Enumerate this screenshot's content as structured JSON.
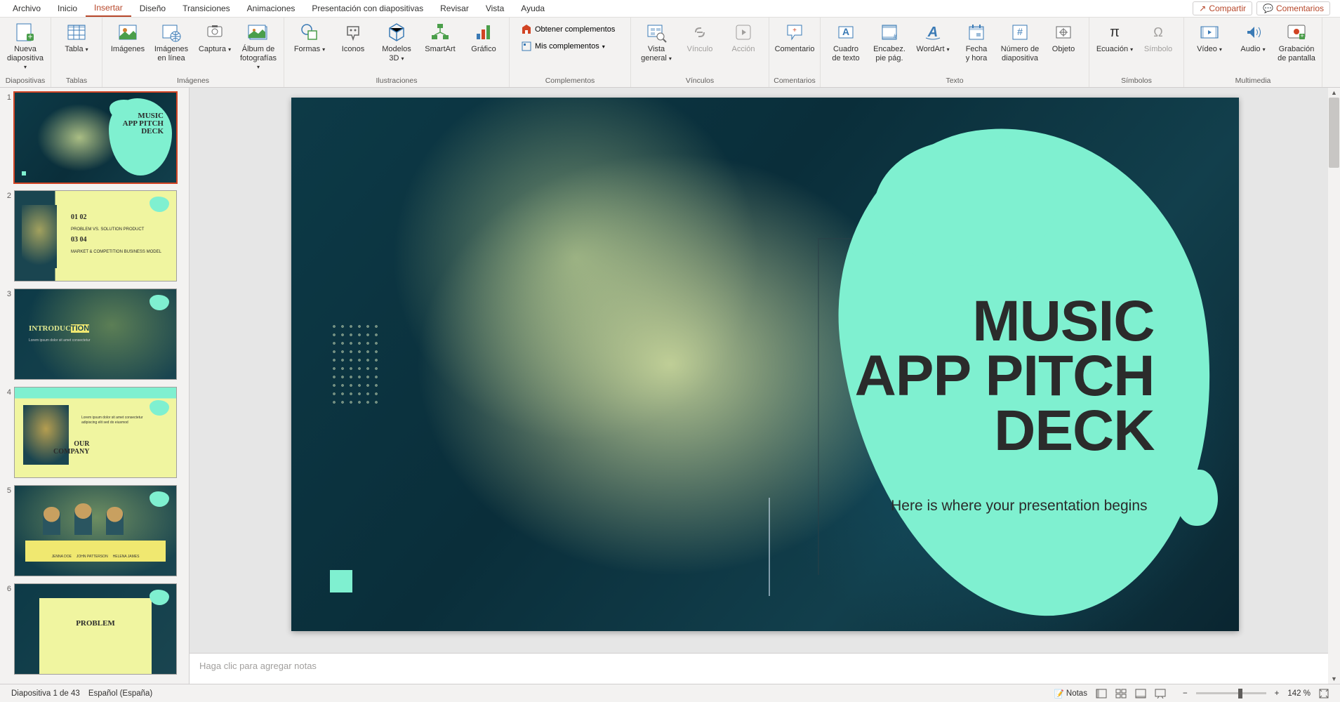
{
  "tabs": [
    "Archivo",
    "Inicio",
    "Insertar",
    "Diseño",
    "Transiciones",
    "Animaciones",
    "Presentación con diapositivas",
    "Revisar",
    "Vista",
    "Ayuda"
  ],
  "active_tab": 2,
  "top_actions": {
    "share": "Compartir",
    "comments": "Comentarios"
  },
  "ribbon": {
    "groups": [
      {
        "label": "Diapositivas",
        "items": [
          {
            "label": "Nueva\ndiapositiva",
            "icon": "new-slide",
            "dd": true
          }
        ]
      },
      {
        "label": "Tablas",
        "items": [
          {
            "label": "Tabla",
            "icon": "table",
            "dd": true
          }
        ]
      },
      {
        "label": "Imágenes",
        "items": [
          {
            "label": "Imágenes",
            "icon": "images"
          },
          {
            "label": "Imágenes\nen línea",
            "icon": "images-online"
          },
          {
            "label": "Captura",
            "icon": "screenshot",
            "dd": true
          },
          {
            "label": "Álbum de\nfotografías",
            "icon": "album",
            "dd": true
          }
        ]
      },
      {
        "label": "Ilustraciones",
        "items": [
          {
            "label": "Formas",
            "icon": "shapes",
            "dd": true
          },
          {
            "label": "Iconos",
            "icon": "icons"
          },
          {
            "label": "Modelos\n3D",
            "icon": "3d",
            "dd": true
          },
          {
            "label": "SmartArt",
            "icon": "smartart"
          },
          {
            "label": "Gráfico",
            "icon": "chart"
          }
        ]
      },
      {
        "label": "Complementos",
        "items_sm": [
          {
            "label": "Obtener complementos",
            "icon": "store"
          },
          {
            "label": "Mis complementos",
            "icon": "myaddins",
            "dd": true
          }
        ]
      },
      {
        "label": "Vínculos",
        "items": [
          {
            "label": "Vista\ngeneral",
            "icon": "zoom",
            "dd": true
          },
          {
            "label": "Vínculo",
            "icon": "link",
            "dis": true
          },
          {
            "label": "Acción",
            "icon": "action",
            "dis": true
          }
        ]
      },
      {
        "label": "Comentarios",
        "items": [
          {
            "label": "Comentario",
            "icon": "comment"
          }
        ]
      },
      {
        "label": "Texto",
        "items": [
          {
            "label": "Cuadro\nde texto",
            "icon": "textbox"
          },
          {
            "label": "Encabez.\npie pág.",
            "icon": "header"
          },
          {
            "label": "WordArt",
            "icon": "wordart",
            "dd": true
          },
          {
            "label": "Fecha\ny hora",
            "icon": "date"
          },
          {
            "label": "Número de\ndiapositiva",
            "icon": "slidenum"
          },
          {
            "label": "Objeto",
            "icon": "object"
          }
        ]
      },
      {
        "label": "Símbolos",
        "items": [
          {
            "label": "Ecuación",
            "icon": "equation",
            "dd": true
          },
          {
            "label": "Símbolo",
            "icon": "symbol",
            "dis": true
          }
        ]
      },
      {
        "label": "Multimedia",
        "items": [
          {
            "label": "Vídeo",
            "icon": "video",
            "dd": true
          },
          {
            "label": "Audio",
            "icon": "audio",
            "dd": true
          },
          {
            "label": "Grabación\nde pantalla",
            "icon": "screenrec"
          }
        ]
      }
    ]
  },
  "thumbnails": [
    {
      "n": 1,
      "title": "MUSIC\nAPP PITCH\nDECK",
      "sel": true,
      "type": "title"
    },
    {
      "n": 2,
      "title": "01 02\n03 04",
      "type": "grid"
    },
    {
      "n": 3,
      "title": "INTRODUCTION",
      "type": "intro"
    },
    {
      "n": 4,
      "title": "OUR\nCOMPANY",
      "type": "company"
    },
    {
      "n": 5,
      "title": "",
      "type": "team"
    },
    {
      "n": 6,
      "title": "PROBLEM",
      "type": "problem"
    }
  ],
  "slide": {
    "title_l1": "MUSIC",
    "title_l2": "APP PITCH",
    "title_l3": "DECK",
    "subtitle": "Here is where your presentation begins"
  },
  "notes_placeholder": "Haga clic para agregar notas",
  "status": {
    "slide_info": "Diapositiva 1 de 43",
    "language": "Español (España)",
    "notes_btn": "Notas",
    "zoom": "142 %"
  },
  "accent": "#b7472a",
  "mint": "#7ff0d0"
}
